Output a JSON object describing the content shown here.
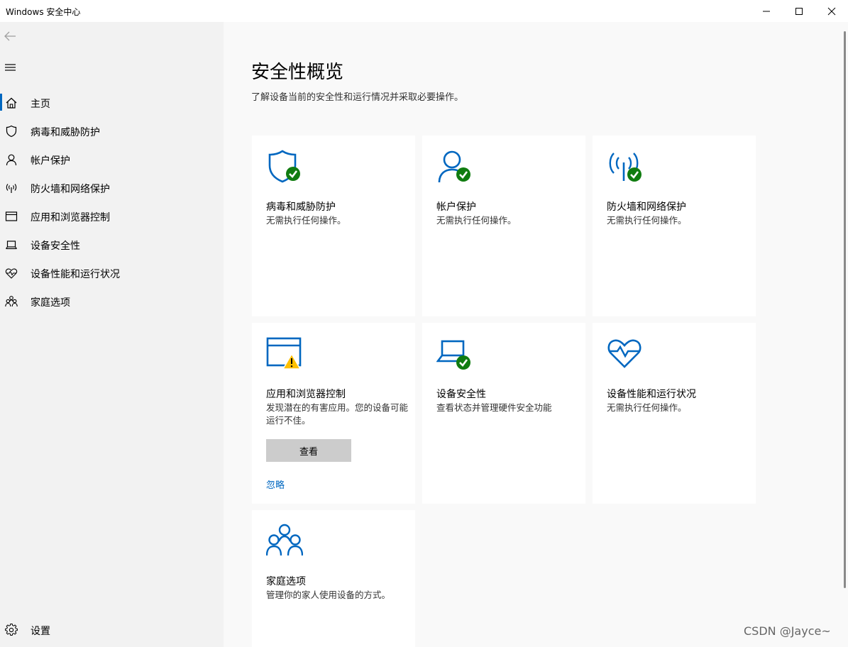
{
  "window": {
    "title": "Windows 安全中心",
    "controls": [
      "minimize",
      "maximize",
      "close"
    ]
  },
  "sidebar": {
    "back_icon": "back-arrow-icon",
    "menu_icon": "hamburger-icon",
    "items": [
      {
        "label": "主页",
        "icon": "home-icon",
        "active": true
      },
      {
        "label": "病毒和威胁防护",
        "icon": "shield-icon"
      },
      {
        "label": "帐户保护",
        "icon": "person-icon"
      },
      {
        "label": "防火墙和网络保护",
        "icon": "wifi-antenna-icon"
      },
      {
        "label": "应用和浏览器控制",
        "icon": "browser-window-icon"
      },
      {
        "label": "设备安全性",
        "icon": "laptop-icon"
      },
      {
        "label": "设备性能和运行状况",
        "icon": "heart-pulse-icon"
      },
      {
        "label": "家庭选项",
        "icon": "family-icon"
      }
    ],
    "settings": {
      "label": "设置",
      "icon": "gear-icon"
    }
  },
  "main": {
    "title": "安全性概览",
    "subtitle": "了解设备当前的安全性和运行情况并采取必要操作。",
    "cards": [
      {
        "title": "病毒和威胁防护",
        "desc": "无需执行任何操作。",
        "icon": "shield-icon",
        "status": "ok"
      },
      {
        "title": "帐户保护",
        "desc": "无需执行任何操作。",
        "icon": "person-icon",
        "status": "ok"
      },
      {
        "title": "防火墙和网络保护",
        "desc": "无需执行任何操作。",
        "icon": "wifi-antenna-icon",
        "status": "ok"
      },
      {
        "title": "应用和浏览器控制",
        "desc": "发现潜在的有害应用。您的设备可能运行不佳。",
        "icon": "browser-window-icon",
        "status": "warning",
        "button": "查看",
        "link": "忽略"
      },
      {
        "title": "设备安全性",
        "desc": "查看状态并管理硬件安全功能",
        "icon": "laptop-icon",
        "status": "ok"
      },
      {
        "title": "设备性能和运行状况",
        "desc": "无需执行任何操作。",
        "icon": "heart-pulse-icon",
        "status": "none"
      },
      {
        "title": "家庭选项",
        "desc": "管理你的家人使用设备的方式。",
        "icon": "family-icon",
        "status": "none"
      }
    ]
  },
  "colors": {
    "accent": "#0067c0",
    "ok": "#107c10",
    "warning": "#ffc000",
    "sidebar_bg": "#f2f2f2",
    "main_bg": "#f9f9f9"
  },
  "watermark": "CSDN @Jayce~"
}
